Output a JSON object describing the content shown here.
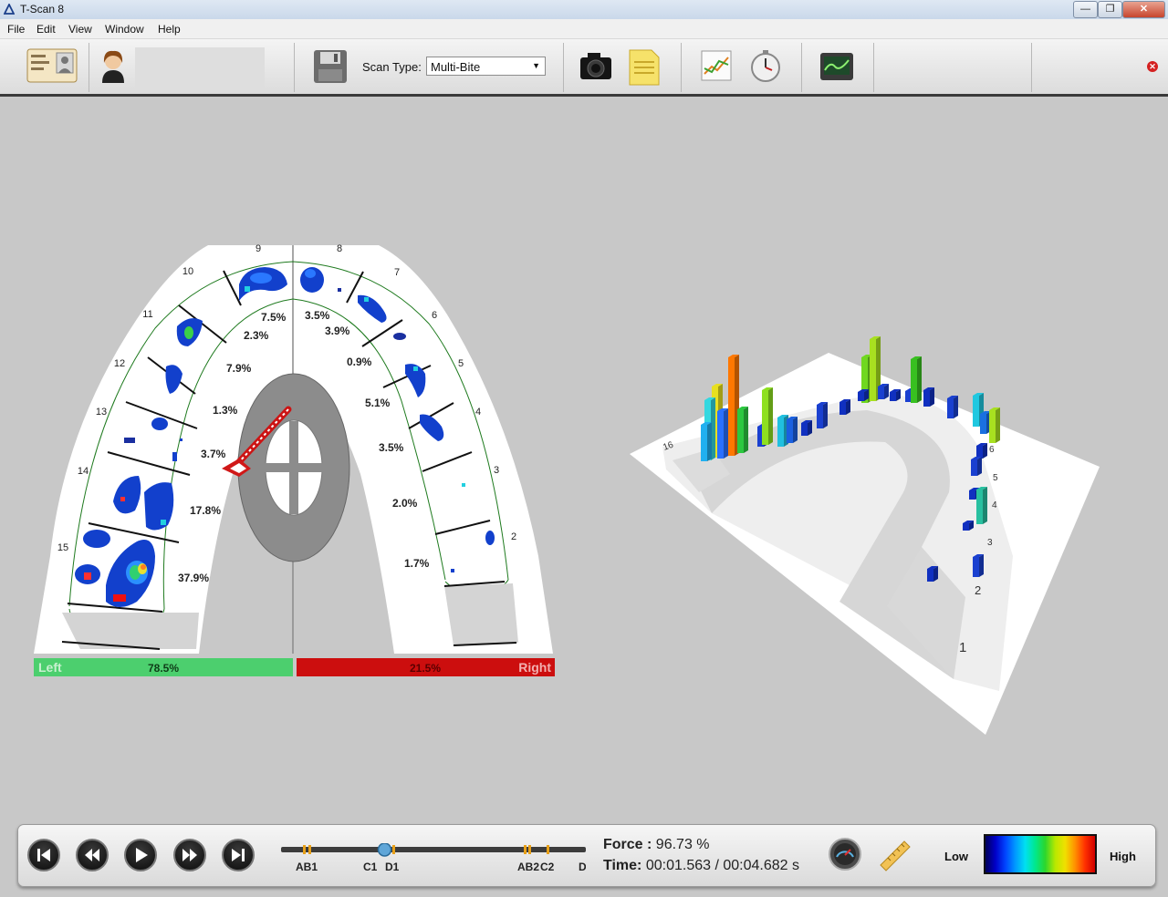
{
  "window": {
    "title": "T-Scan 8",
    "minimize_glyph": "—",
    "restore_glyph": "❐",
    "close_glyph": "✕"
  },
  "menu": [
    "File",
    "Edit",
    "View",
    "Window",
    "Help"
  ],
  "toolbar": {
    "scan_type_label": "Scan Type:",
    "scan_type_value": "Multi-Bite",
    "icons": [
      "patient-id-icon",
      "patient-avatar-icon",
      "save-icon",
      "camera-icon",
      "notes-icon",
      "graph-icon",
      "timer-icon",
      "monitor-icon",
      "close-icon"
    ]
  },
  "arch": {
    "tooth_numbers": [
      "9",
      "8",
      "10",
      "7",
      "11",
      "6",
      "12",
      "5",
      "13",
      "4",
      "14",
      "3",
      "15",
      "2"
    ],
    "left_percentages": [
      "7.5%",
      "2.3%",
      "7.9%",
      "1.3%",
      "3.7%",
      "17.8%",
      "37.9%"
    ],
    "right_percentages": [
      "3.5%",
      "3.9%",
      "0.9%",
      "5.1%",
      "3.5%",
      "2.0%",
      "1.7%"
    ],
    "left_label": "Left",
    "left_value": "78.5%",
    "right_label": "Right",
    "right_value": "21.5%",
    "left_fraction": 0.785,
    "right_fraction": 0.215,
    "left_color": "#4ccf6e",
    "right_color": "#cc0e0e"
  },
  "arch3d": {
    "labels": [
      "16",
      "6",
      "5",
      "4",
      "3",
      "2",
      "1"
    ]
  },
  "playback": {
    "markers": [
      "AB1",
      "C1",
      "D1",
      "AB2",
      "C2",
      "D2"
    ],
    "force_label": "Force :",
    "force_value": "96.73 %",
    "time_label": "Time:",
    "time_value": "00:01.563 / 00:04.682 s",
    "legend_low": "Low",
    "legend_high": "High",
    "progress": 0.334,
    "icons": [
      "skip-start-icon",
      "rewind-icon",
      "play-icon",
      "fast-forward-icon",
      "skip-end-icon",
      "gauge-icon",
      "ruler-icon"
    ]
  },
  "colors": {
    "accent_green": "#4ccf6e",
    "accent_red": "#cc0e0e",
    "background": "#c8c8c8"
  }
}
